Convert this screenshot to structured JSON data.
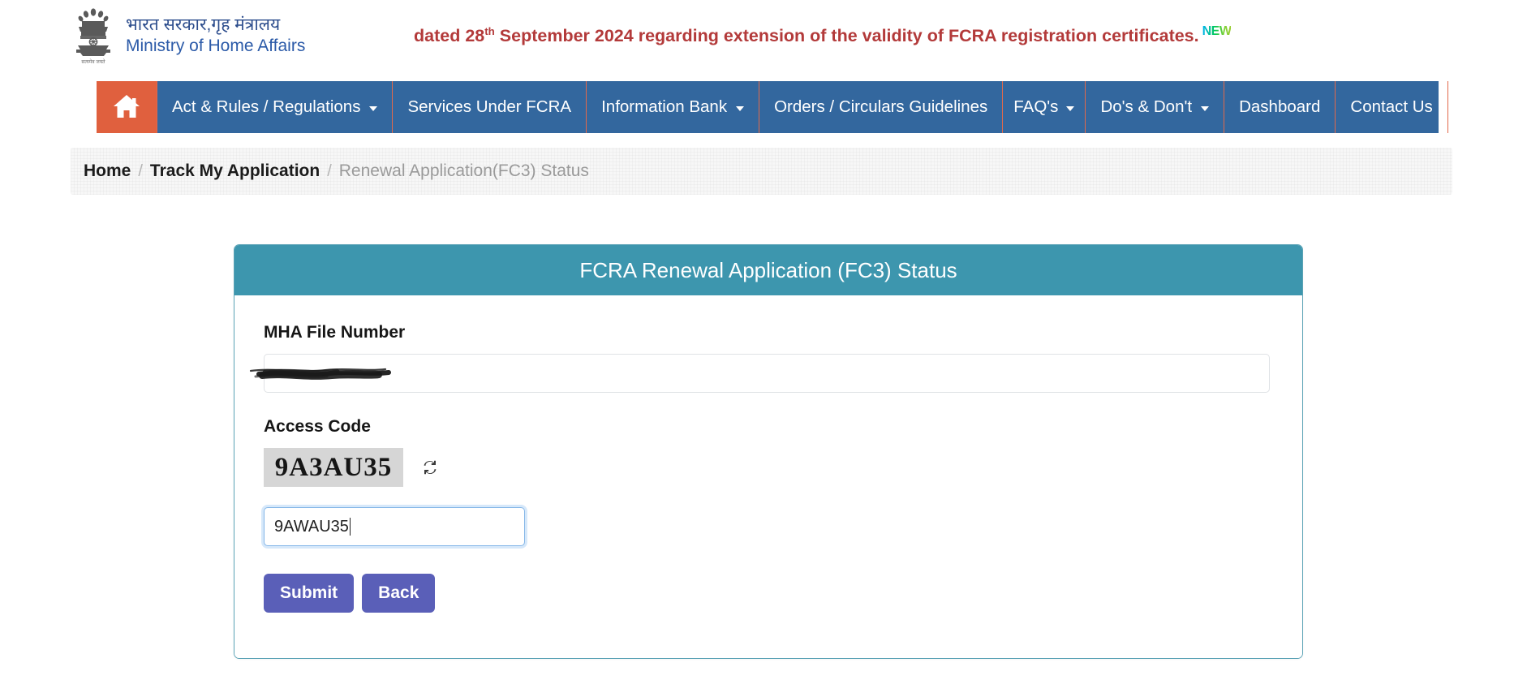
{
  "header": {
    "emblem_alt": "india-national-emblem",
    "gov_name_hindi": "भारत सरकार,गृह मंत्रालय",
    "gov_name_english": "Ministry of Home Affairs",
    "marquee_text_before": "dated 28",
    "marquee_sup": "th",
    "marquee_text_after": " September 2024 regarding extension of the validity of FCRA registration certificates.",
    "new_badge": "NEW"
  },
  "nav": {
    "home_label": "Home",
    "items": [
      {
        "label": "Act & Rules / Regulations",
        "has_caret": true
      },
      {
        "label": "Services Under FCRA",
        "has_caret": false
      },
      {
        "label": "Information Bank",
        "has_caret": true
      },
      {
        "label": "Orders / Circulars Guidelines",
        "has_caret": false
      },
      {
        "label": "FAQ's",
        "has_caret": true
      },
      {
        "label": "Do's & Don't",
        "has_caret": true
      },
      {
        "label": "Dashboard",
        "has_caret": false
      },
      {
        "label": "Contact Us",
        "has_caret": false
      }
    ]
  },
  "breadcrumb": {
    "sep": "/",
    "items": [
      {
        "label": "Home",
        "current": false
      },
      {
        "label": "Track My Application",
        "current": false
      },
      {
        "label": "Renewal Application(FC3) Status",
        "current": true
      }
    ]
  },
  "card": {
    "title": "FCRA Renewal Application (FC3) Status",
    "mha_file_number": {
      "label": "MHA File Number",
      "value": "",
      "placeholder": "",
      "redacted": true
    },
    "access_code": {
      "label": "Access Code",
      "captcha_text": "9A3AU35",
      "refresh_icon": "refresh-icon",
      "input_value": "9AWAU35",
      "input_placeholder": "",
      "focused": true
    },
    "buttons": {
      "submit_label": "Submit",
      "back_label": "Back"
    }
  },
  "colors": {
    "nav_blue": "#33679E",
    "home_orange": "#E0603E",
    "card_teal": "#3D96AE",
    "button_indigo": "#5A5FB8",
    "marquee_red": "#B33A3A",
    "gov_text_blue": "#2B5AA8",
    "breadcrumb_bg": "#F7F7F7"
  }
}
